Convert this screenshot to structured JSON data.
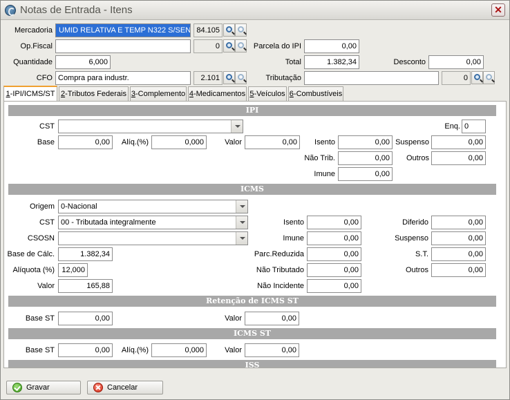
{
  "window": {
    "title": "Notas de Entrada - Itens",
    "close_glyph": "✕"
  },
  "header": {
    "mercadoria": {
      "label": "Mercadoria",
      "value": "UMID RELATIVA E TEMP N322 S/SENSOR",
      "code": "84.105"
    },
    "opfiscal": {
      "label": "Op.Fiscal",
      "value": "",
      "code": "0"
    },
    "parcela_ipi": {
      "label": "Parcela do IPI",
      "value": "0,00"
    },
    "quantidade": {
      "label": "Quantidade",
      "value": "6,000"
    },
    "total": {
      "label": "Total",
      "value": "1.382,34"
    },
    "desconto": {
      "label": "Desconto",
      "value": "0,00"
    },
    "cfo": {
      "label": "CFO",
      "value": "Compra para industr.",
      "code": "2.101"
    },
    "tributacao": {
      "label": "Tributação",
      "value": "",
      "code": "0"
    }
  },
  "tabs": [
    {
      "key": "1",
      "label": "-IPI/ICMS/ST"
    },
    {
      "key": "2",
      "label": "-Tributos Federais"
    },
    {
      "key": "3",
      "label": "-Complemento"
    },
    {
      "key": "4",
      "label": "-Medicamentos"
    },
    {
      "key": "5",
      "label": "-Veículos"
    },
    {
      "key": "6",
      "label": "-Combustíveis"
    }
  ],
  "ipi": {
    "section": "IPI",
    "cst_label": "CST",
    "cst_value": "",
    "enq_label": "Enq.",
    "enq_value": "0",
    "base_label": "Base",
    "base_value": "0,00",
    "aliq_label": "Alíq.(%)",
    "aliq_value": "0,000",
    "valor_label": "Valor",
    "valor_value": "0,00",
    "isento_label": "Isento",
    "isento_value": "0,00",
    "suspenso_label": "Suspenso",
    "suspenso_value": "0,00",
    "naotrib_label": "Não Trib.",
    "naotrib_value": "0,00",
    "outros_label": "Outros",
    "outros_value": "0,00",
    "imune_label": "Imune",
    "imune_value": "0,00"
  },
  "icms": {
    "section": "ICMS",
    "origem_label": "Origem",
    "origem_value": "0-Nacional",
    "cst_label": "CST",
    "cst_value": "00 - Tributada integralmente",
    "csosn_label": "CSOSN",
    "csosn_value": "",
    "basecalc_label": "Base de Cálc.",
    "basecalc_value": "1.382,34",
    "aliquota_label": "Alíquota (%)",
    "aliquota_value": "12,000",
    "valor_label": "Valor",
    "valor_value": "165,88",
    "isento_label": "Isento",
    "isento_value": "0,00",
    "imune_label": "Imune",
    "imune_value": "0,00",
    "parcred_label": "Parc.Reduzida",
    "parcred_value": "0,00",
    "naotrib_label": "Não Tributado",
    "naotrib_value": "0,00",
    "naoinc_label": "Não Incidente",
    "naoinc_value": "0,00",
    "diferido_label": "Diferido",
    "diferido_value": "0,00",
    "suspenso_label": "Suspenso",
    "suspenso_value": "0,00",
    "st_label": "S.T.",
    "st_value": "0,00",
    "outros_label": "Outros",
    "outros_value": "0,00"
  },
  "retencao": {
    "section": "Retenção de ICMS ST",
    "basest_label": "Base ST",
    "basest_value": "0,00",
    "valor_label": "Valor",
    "valor_value": "0,00"
  },
  "icmsst": {
    "section": "ICMS ST",
    "basest_label": "Base ST",
    "basest_value": "0,00",
    "aliq_label": "Alíq.(%)",
    "aliq_value": "0,000",
    "valor_label": "Valor",
    "valor_value": "0,00"
  },
  "iss": {
    "section": "ISS"
  },
  "footer": {
    "gravar": "Gravar",
    "cancelar": "Cancelar"
  },
  "icons": {
    "app": "app-logo-icon",
    "search": "magnifier-icon",
    "ok": "green-check-icon",
    "cancel": "red-x-icon"
  }
}
